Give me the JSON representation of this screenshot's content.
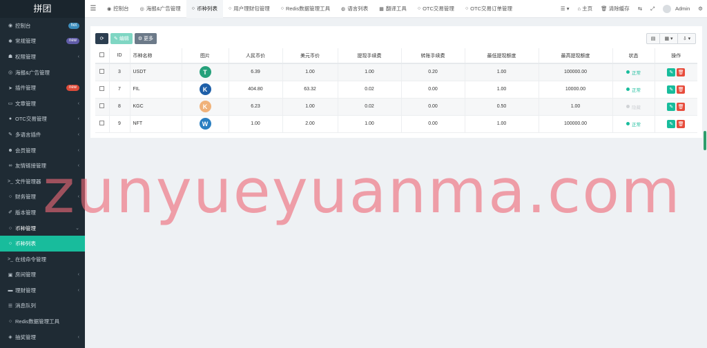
{
  "sidebar": {
    "brand": "拼团",
    "items": [
      {
        "label": "控制台",
        "icon": "dashboard-icon",
        "glyph": "◉",
        "badge": "hot",
        "badge_color": "blue",
        "chevron": false
      },
      {
        "label": "常规管理",
        "icon": "cogs-icon",
        "glyph": "✱",
        "badge": "new",
        "badge_color": "purple",
        "chevron": false
      },
      {
        "label": "权限管理",
        "icon": "group-icon",
        "glyph": "☗",
        "badge": "",
        "chevron": true
      },
      {
        "label": "海报&广告管理",
        "icon": "poster-icon",
        "glyph": "◎",
        "badge": "",
        "chevron": false
      },
      {
        "label": "插件管理",
        "icon": "rocket-icon",
        "glyph": "➤",
        "badge": "new",
        "badge_color": "red",
        "chevron": false
      },
      {
        "label": "文章管理",
        "icon": "folder-icon",
        "glyph": "▭",
        "badge": "",
        "chevron": true
      },
      {
        "label": "OTC交易管理",
        "icon": "circle-icon",
        "glyph": "●",
        "badge": "",
        "chevron": true
      },
      {
        "label": "多语言插件",
        "icon": "magic-icon",
        "glyph": "✎",
        "badge": "",
        "chevron": true
      },
      {
        "label": "会员管理",
        "icon": "user-icon",
        "glyph": "☻",
        "badge": "",
        "chevron": true
      },
      {
        "label": "友情链接管理",
        "icon": "link-icon",
        "glyph": "∞",
        "badge": "",
        "chevron": true
      },
      {
        "label": "文件管理器",
        "icon": "terminal-icon",
        "glyph": ">_",
        "badge": "",
        "chevron": false
      },
      {
        "label": "财务管理",
        "icon": "circle-outline-icon",
        "glyph": "○",
        "badge": "",
        "chevron": true
      },
      {
        "label": "版本管理",
        "icon": "edit-icon",
        "glyph": "✐",
        "badge": "",
        "chevron": false
      },
      {
        "label": "币种管理",
        "icon": "circle-outline-icon",
        "glyph": "○",
        "badge": "",
        "chevron": true,
        "expanded": true
      },
      {
        "label": "币种列表",
        "icon": "circle-outline-icon",
        "glyph": "○",
        "badge": "",
        "chevron": false,
        "active": true
      },
      {
        "label": "在线命令管理",
        "icon": "terminal-icon",
        "glyph": ">_",
        "badge": "",
        "chevron": false
      },
      {
        "label": "房间管理",
        "icon": "room-icon",
        "glyph": "▣",
        "badge": "",
        "chevron": true
      },
      {
        "label": "理财管理",
        "icon": "money-icon",
        "glyph": "▬",
        "badge": "",
        "chevron": true
      },
      {
        "label": "消息队列",
        "icon": "list-icon",
        "glyph": "☰",
        "badge": "",
        "chevron": false
      },
      {
        "label": "Redis数据管理工具",
        "icon": "circle-outline-icon",
        "glyph": "○",
        "badge": "",
        "chevron": false
      },
      {
        "label": "抽奖管理",
        "icon": "gift-icon",
        "glyph": "◈",
        "badge": "",
        "chevron": true
      }
    ]
  },
  "topbar": {
    "tabs": [
      {
        "label": "控制台",
        "icon": "dashboard-icon",
        "glyph": "◉",
        "active": false
      },
      {
        "label": "海报&广告管理",
        "icon": "poster-icon",
        "glyph": "◎",
        "active": false
      },
      {
        "label": "币种列表",
        "icon": "circle-outline-icon",
        "glyph": "○",
        "active": true
      },
      {
        "label": "用户理财包管理",
        "icon": "circle-outline-icon",
        "glyph": "○",
        "active": false
      },
      {
        "label": "Redis数据管理工具",
        "icon": "circle-outline-icon",
        "glyph": "○",
        "active": false
      },
      {
        "label": "语言列表",
        "icon": "globe-icon",
        "glyph": "◍",
        "active": false
      },
      {
        "label": "翻译工具",
        "icon": "translate-icon",
        "glyph": "▦",
        "active": false
      },
      {
        "label": "OTC交易管理",
        "icon": "circle-outline-icon",
        "glyph": "○",
        "active": false
      },
      {
        "label": "OTC交易订单管理",
        "icon": "circle-outline-icon",
        "glyph": "○",
        "active": false
      }
    ],
    "home": "主页",
    "clear_cache": "清除缓存",
    "admin": "Admin"
  },
  "toolbar": {
    "refresh": "⟳",
    "edit": "编辑",
    "more": "更多"
  },
  "table": {
    "headers": [
      "",
      "ID",
      "币种名称",
      "图片",
      "人民币价",
      "美元币价",
      "提现手续费",
      "转账手续费",
      "最低提现额度",
      "最高提现额度",
      "状态",
      "操作"
    ],
    "rows": [
      {
        "id": "3",
        "name": "USDT",
        "cny": "6.39",
        "usd": "1.00",
        "withdraw_fee": "1.00",
        "transfer_fee": "0.20",
        "min": "1.00",
        "max": "100000.00",
        "status": "正常",
        "status_color": "#18bc9c",
        "coin_color": "#26a17b",
        "coin_glyph": "T"
      },
      {
        "id": "7",
        "name": "FIL",
        "cny": "404.80",
        "usd": "63.32",
        "withdraw_fee": "0.02",
        "transfer_fee": "0.00",
        "min": "1.00",
        "max": "10000.00",
        "status": "正常",
        "status_color": "#18bc9c",
        "coin_color": "#1e5fa8",
        "coin_glyph": "K"
      },
      {
        "id": "8",
        "name": "KGC",
        "cny": "6.23",
        "usd": "1.00",
        "withdraw_fee": "0.02",
        "transfer_fee": "0.00",
        "min": "0.50",
        "max": "1.00",
        "status": "隐藏",
        "status_color": "#d0d3d6",
        "coin_color": "#f0b27a",
        "coin_glyph": "K"
      },
      {
        "id": "9",
        "name": "NFT",
        "cny": "1.00",
        "usd": "2.00",
        "withdraw_fee": "1.00",
        "transfer_fee": "0.00",
        "min": "1.00",
        "max": "100000.00",
        "status": "正常",
        "status_color": "#18bc9c",
        "coin_color": "#2a7fc1",
        "coin_glyph": "W"
      }
    ]
  },
  "watermark": "zunyueyuanma.com"
}
